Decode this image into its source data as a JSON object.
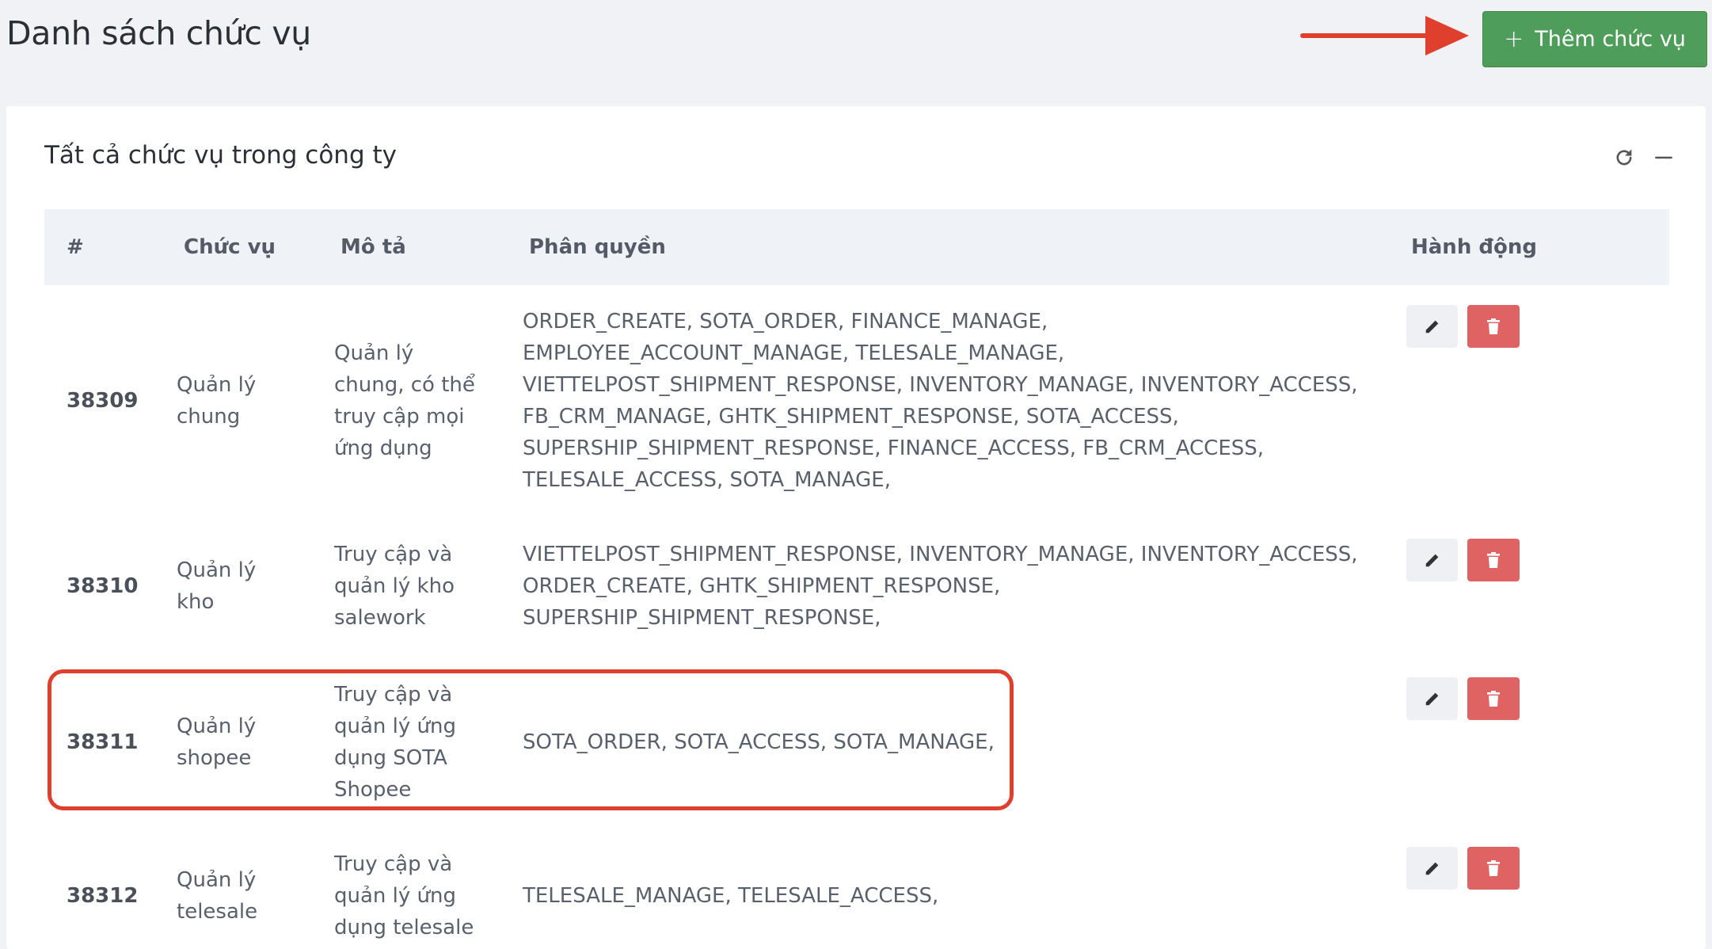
{
  "page": {
    "title": "Danh sách chức vụ"
  },
  "add_button": {
    "icon": "plus-icon",
    "label": "Thêm chức vụ"
  },
  "card": {
    "title": "Tất cả chức vụ trong công ty",
    "tools": [
      "refresh-icon",
      "minus-icon"
    ]
  },
  "table": {
    "headers": {
      "id": "#",
      "role": "Chức vụ",
      "desc": "Mô tả",
      "perm": "Phân quyền",
      "action": "Hành động"
    },
    "rows": [
      {
        "id": "38309",
        "role": [
          "Quản lý",
          "chung"
        ],
        "desc": [
          "Quản lý",
          "chung, có thể",
          "truy cập mọi",
          "ứng dụng"
        ],
        "perm": [
          "ORDER_CREATE, SOTA_ORDER, FINANCE_MANAGE,",
          "EMPLOYEE_ACCOUNT_MANAGE, TELESALE_MANAGE,",
          "VIETTELPOST_SHIPMENT_RESPONSE, INVENTORY_MANAGE, INVENTORY_ACCESS,",
          "FB_CRM_MANAGE, GHTK_SHIPMENT_RESPONSE, SOTA_ACCESS,",
          "SUPERSHIP_SHIPMENT_RESPONSE, FINANCE_ACCESS, FB_CRM_ACCESS,",
          "TELESALE_ACCESS, SOTA_MANAGE,"
        ]
      },
      {
        "id": "38310",
        "role": [
          "Quản lý",
          "kho"
        ],
        "desc": [
          "Truy cập và",
          "quản lý kho",
          "salework"
        ],
        "perm": [
          "VIETTELPOST_SHIPMENT_RESPONSE, INVENTORY_MANAGE, INVENTORY_ACCESS,",
          "ORDER_CREATE, GHTK_SHIPMENT_RESPONSE,",
          "SUPERSHIP_SHIPMENT_RESPONSE,"
        ]
      },
      {
        "id": "38311",
        "role": [
          "Quản lý",
          "shopee"
        ],
        "desc": [
          "Truy cập và",
          "quản lý ứng",
          "dụng SOTA",
          "Shopee"
        ],
        "perm": [
          "SOTA_ORDER, SOTA_ACCESS, SOTA_MANAGE,"
        ]
      },
      {
        "id": "38312",
        "role": [
          "Quản lý",
          "telesale"
        ],
        "desc": [
          "Truy cập và",
          "quản lý ứng",
          "dụng telesale"
        ],
        "perm": [
          "TELESALE_MANAGE, TELESALE_ACCESS,"
        ]
      }
    ]
  },
  "colors": {
    "accent_green": "#4f9d5a",
    "delete_red": "#e06363",
    "annotation_red": "#df3f2d"
  }
}
